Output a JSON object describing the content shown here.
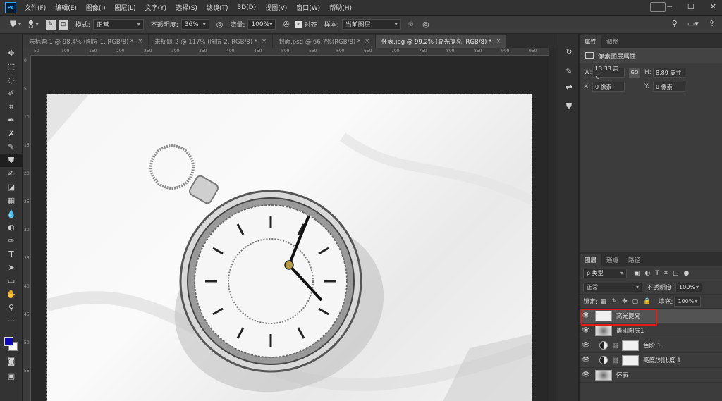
{
  "app": {
    "logo": "Ps"
  },
  "menu": [
    "文件(F)",
    "编辑(E)",
    "图像(I)",
    "图层(L)",
    "文字(Y)",
    "选择(S)",
    "滤镜(T)",
    "3D(D)",
    "视图(V)",
    "窗口(W)",
    "帮助(H)"
  ],
  "options": {
    "brush_size": "13",
    "mode_label": "模式:",
    "mode_value": "正常",
    "opacity_label": "不透明度:",
    "opacity_value": "36%",
    "flow_label": "流量:",
    "flow_value": "100%",
    "align_label": "对齐",
    "sample_label": "样本:",
    "sample_value": "当前图层"
  },
  "tabs": [
    {
      "label": "未标题-1 @ 98.4% (图层 1, RGB/8) *"
    },
    {
      "label": "未标题-2 @ 117% (图层 2, RGB/8) *"
    },
    {
      "label": "封面.psd @ 66.7%(RGB/8) *"
    },
    {
      "label": "怀表.jpg @ 99.2% (高光提亮, RGB/8) *"
    }
  ],
  "ruler_top": [
    "50",
    "100",
    "150",
    "200",
    "250",
    "300",
    "350",
    "400",
    "450",
    "500",
    "550",
    "600",
    "650",
    "700",
    "750",
    "800",
    "850",
    "900",
    "950"
  ],
  "ruler_left": [
    "0",
    "5",
    "10",
    "15",
    "20",
    "25",
    "30",
    "35",
    "40",
    "45",
    "50",
    "55"
  ],
  "properties": {
    "tabs": [
      "属性",
      "调整"
    ],
    "title": "像素图层属性",
    "w_label": "W:",
    "w_value": "13.33 英寸",
    "h_label": "H:",
    "h_value": "8.89 英寸",
    "x_label": "X:",
    "x_value": "0 像素",
    "y_label": "Y:",
    "y_value": "0 像素",
    "link": "GO"
  },
  "layers": {
    "tabs": [
      "图层",
      "通道",
      "路径"
    ],
    "filter_kind": "ρ 类型",
    "blend_mode": "正常",
    "opacity_label": "不透明度:",
    "opacity_value": "100%",
    "lock_label": "锁定:",
    "fill_label": "填充:",
    "fill_value": "100%",
    "items": [
      {
        "name": "高光提亮"
      },
      {
        "name": "盖印图层1"
      },
      {
        "name": "色阶 1"
      },
      {
        "name": "亮度/对比度 1"
      },
      {
        "name": "怀表"
      }
    ]
  },
  "colors": {
    "foreground": "#1008b8",
    "background": "#ffffff",
    "highlight_box": "#e21b1b"
  }
}
